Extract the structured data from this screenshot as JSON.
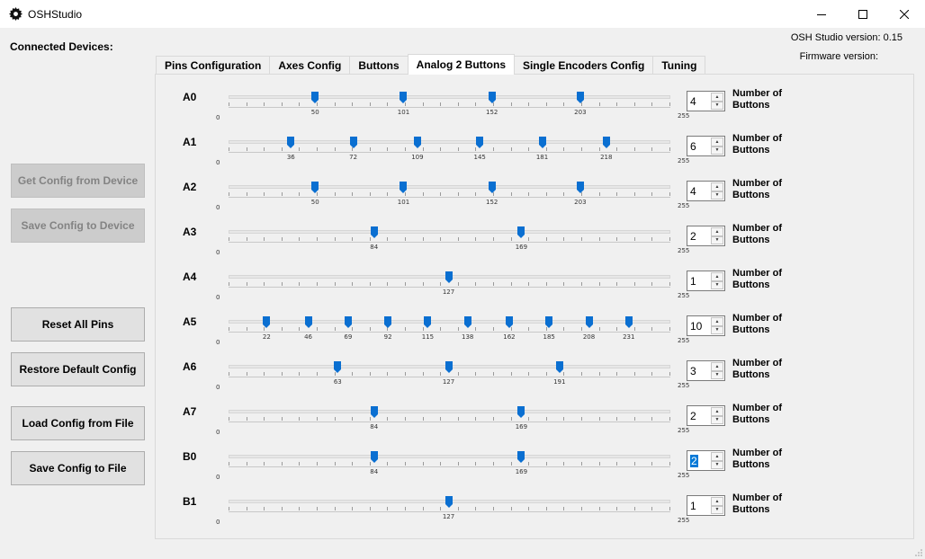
{
  "window": {
    "title": "OSHStudio"
  },
  "header": {
    "connected_label": "Connected Devices:",
    "version_label": "OSH Studio version:",
    "version_value": "0.15",
    "firmware_label": "Firmware version:"
  },
  "side_buttons": [
    {
      "label": "Get Config from Device",
      "enabled": false
    },
    {
      "label": "Save Config to Device",
      "enabled": false
    },
    {
      "label": "Reset All Pins",
      "enabled": true
    },
    {
      "label": "Restore Default Config",
      "enabled": true
    },
    {
      "label": "Load Config from File",
      "enabled": true
    },
    {
      "label": "Save Config to File",
      "enabled": true
    }
  ],
  "tabs": [
    {
      "label": "Pins Configuration"
    },
    {
      "label": "Axes Config"
    },
    {
      "label": "Buttons"
    },
    {
      "label": "Analog 2 Buttons"
    },
    {
      "label": "Single Encoders Config"
    },
    {
      "label": "Tuning"
    }
  ],
  "active_tab": "Analog 2 Buttons",
  "slider_range": {
    "min": "0",
    "max": "255"
  },
  "number_label_line1": "Number of",
  "number_label_line2": "Buttons",
  "colors": {
    "handle": "#0a6fd1",
    "selection": "#0078d7"
  },
  "rows": [
    {
      "pin": "A0",
      "count": "4",
      "values": [
        50,
        101,
        152,
        203
      ]
    },
    {
      "pin": "A1",
      "count": "6",
      "values": [
        36,
        72,
        109,
        145,
        181,
        218
      ]
    },
    {
      "pin": "A2",
      "count": "4",
      "values": [
        50,
        101,
        152,
        203
      ]
    },
    {
      "pin": "A3",
      "count": "2",
      "values": [
        84,
        169
      ]
    },
    {
      "pin": "A4",
      "count": "1",
      "values": [
        127
      ]
    },
    {
      "pin": "A5",
      "count": "10",
      "values": [
        22,
        46,
        69,
        92,
        115,
        138,
        162,
        185,
        208,
        231
      ]
    },
    {
      "pin": "A6",
      "count": "3",
      "values": [
        63,
        127,
        191
      ]
    },
    {
      "pin": "A7",
      "count": "2",
      "values": [
        84,
        169
      ]
    },
    {
      "pin": "B0",
      "count": "2",
      "values": [
        84,
        169
      ],
      "selected": true
    },
    {
      "pin": "B1",
      "count": "1",
      "values": [
        127
      ]
    }
  ]
}
